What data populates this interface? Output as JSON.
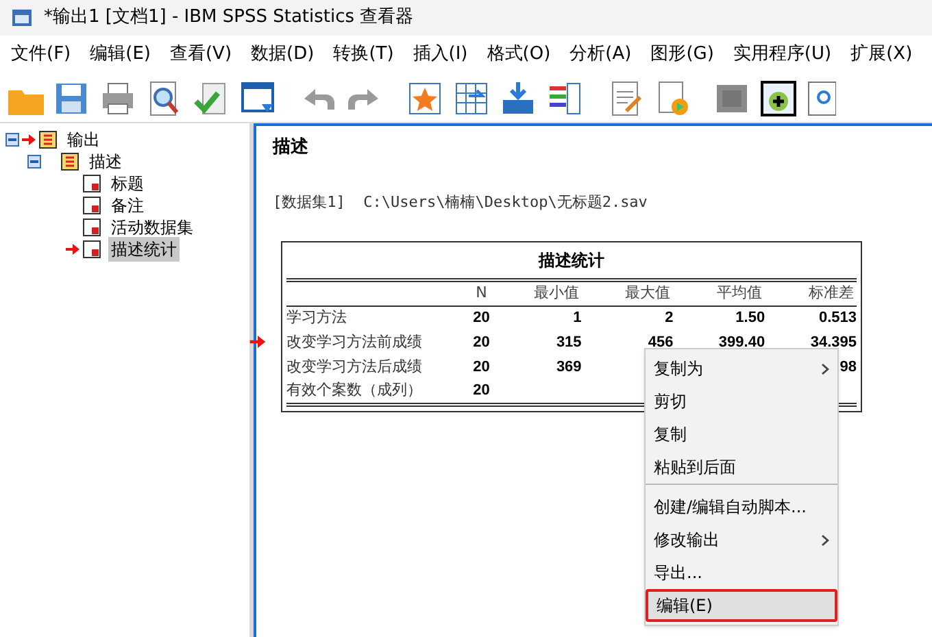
{
  "window": {
    "title": "*输出1 [文档1] - IBM SPSS Statistics 查看器"
  },
  "menu_bar": [
    "文件(F)",
    "编辑(E)",
    "查看(V)",
    "数据(D)",
    "转换(T)",
    "插入(I)",
    "格式(O)",
    "分析(A)",
    "图形(G)",
    "实用程序(U)",
    "扩展(X)"
  ],
  "outline": [
    {
      "label": "输出",
      "marked": true,
      "selected": false,
      "expanded": true,
      "children": [
        {
          "label": "描述",
          "marked": false,
          "selected": false,
          "expanded": true,
          "children": [
            {
              "label": "标题",
              "marked": false,
              "selected": false
            },
            {
              "label": "备注",
              "marked": false,
              "selected": false
            },
            {
              "label": "活动数据集",
              "marked": false,
              "selected": false
            },
            {
              "label": "描述统计",
              "marked": true,
              "selected": true
            }
          ]
        }
      ]
    }
  ],
  "output": {
    "heading": "描述",
    "dataset_line": "[数据集1]  C:\\Users\\楠楠\\Desktop\\无标题2.sav",
    "table": {
      "title": "描述统计",
      "columns": [
        "N",
        "最小值",
        "最大值",
        "平均值",
        "标准差"
      ],
      "rows": [
        {
          "label": "学习方法",
          "marked": false,
          "cells": [
            "20",
            "1",
            "2",
            "1.50",
            "0.513"
          ]
        },
        {
          "label": "改变学习方法前成绩",
          "marked": true,
          "cells": [
            "20",
            "315",
            "456",
            "399.40",
            "34.395"
          ]
        },
        {
          "label": "改变学习方法后成绩",
          "marked": false,
          "cells": [
            "20",
            "369",
            "",
            "",
            "98"
          ]
        },
        {
          "label": "有效个案数（成列）",
          "marked": false,
          "cells": [
            "20",
            "",
            "",
            "",
            ""
          ]
        }
      ]
    }
  },
  "context_menu": [
    {
      "label": "复制为",
      "submenu": true,
      "separator_after": false,
      "selected": false
    },
    {
      "label": "剪切",
      "submenu": false,
      "separator_after": false,
      "selected": false
    },
    {
      "label": "复制",
      "submenu": false,
      "separator_after": false,
      "selected": false
    },
    {
      "label": "粘贴到后面",
      "submenu": false,
      "separator_after": true,
      "selected": false
    },
    {
      "label": "创建/编辑自动脚本...",
      "submenu": false,
      "separator_after": false,
      "selected": false
    },
    {
      "label": "修改输出",
      "submenu": true,
      "separator_after": false,
      "selected": false
    },
    {
      "label": "导出...",
      "submenu": false,
      "separator_after": false,
      "selected": false
    },
    {
      "label": "编辑(E)",
      "submenu": false,
      "separator_after": false,
      "selected": true
    }
  ]
}
